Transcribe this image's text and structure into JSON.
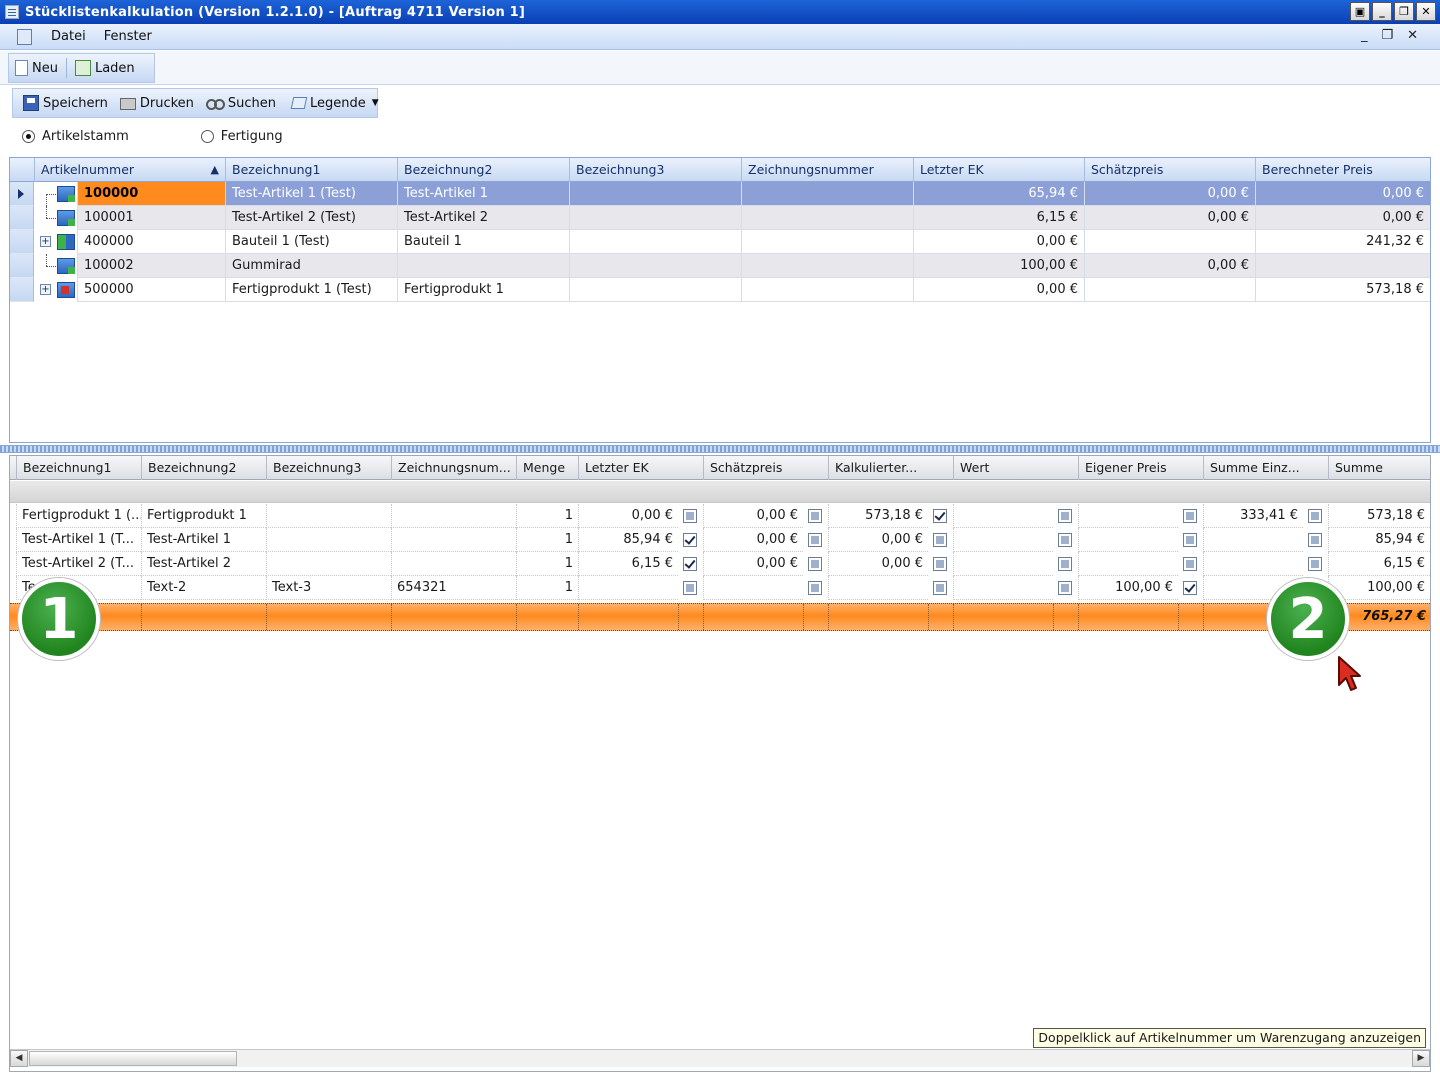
{
  "window": {
    "title": "Stücklistenkalkulation (Version 1.2.1.0) - [Auftrag 4711 Version 1]",
    "buttons": [
      "▣",
      "_",
      "❐",
      "✕"
    ]
  },
  "menu": {
    "items": [
      "Datei",
      "Fenster"
    ],
    "mdi_buttons": [
      "_",
      "❐",
      "✕"
    ]
  },
  "toolbar1": {
    "new_label": "Neu",
    "load_label": "Laden"
  },
  "toolbar2": {
    "save_label": "Speichern",
    "print_label": "Drucken",
    "search_label": "Suchen",
    "legend_label": "Legende"
  },
  "radios": {
    "opt1": "Artikelstamm",
    "opt2": "Fertigung"
  },
  "top_grid": {
    "columns": [
      "Artikelnummer",
      "Bezeichnung1",
      "Bezeichnung2",
      "Bezeichnung3",
      "Zeichnungsnummer",
      "Letzter EK",
      "Schätzpreis",
      "Berechneter Preis"
    ],
    "rows": [
      {
        "artnr": "100000",
        "bez1": "Test-Artikel 1  (Test)",
        "bez2": "Test-Artikel 1",
        "bez3": "",
        "zeich": "",
        "ek": "65,94 €",
        "schaetz": "0,00 €",
        "preis": "0,00 €"
      },
      {
        "artnr": "100001",
        "bez1": "Test-Artikel 2  (Test)",
        "bez2": "Test-Artikel 2",
        "bez3": "",
        "zeich": "",
        "ek": "6,15 €",
        "schaetz": "0,00 €",
        "preis": "0,00 €"
      },
      {
        "artnr": "400000",
        "bez1": "Bauteil 1  (Test)",
        "bez2": "Bauteil 1",
        "bez3": "",
        "zeich": "",
        "ek": "0,00 €",
        "schaetz": "",
        "preis": "241,32 €"
      },
      {
        "artnr": "100002",
        "bez1": "Gummirad",
        "bez2": "",
        "bez3": "",
        "zeich": "",
        "ek": "100,00 €",
        "schaetz": "0,00 €",
        "preis": ""
      },
      {
        "artnr": "500000",
        "bez1": "Fertigprodukt 1  (Test)",
        "bez2": "Fertigprodukt 1",
        "bez3": "",
        "zeich": "",
        "ek": "0,00 €",
        "schaetz": "",
        "preis": "573,18 €"
      }
    ]
  },
  "bottom_grid": {
    "columns": [
      "Bezeichnung1",
      "Bezeichnung2",
      "Bezeichnung3",
      "Zeichnungsnum...",
      "Menge",
      "Letzter EK",
      "Schätzpreis",
      "Kalkulierter...",
      "Wert",
      "Eigener Preis",
      "Summe Einz...",
      "Summe"
    ],
    "rows": [
      {
        "bez1": "Fertigprodukt 1   (...",
        "bez2": "Fertigprodukt 1",
        "bez3": "",
        "zeich": "",
        "menge": "1",
        "ek": "0,00 €",
        "schaetz": "0,00 €",
        "kalk": "573,18 €",
        "wert": "",
        "eigen": "",
        "einz": "333,41 €",
        "summe": "573,18 €"
      },
      {
        "bez1": "Test-Artikel 1   (T...",
        "bez2": "Test-Artikel 1",
        "bez3": "",
        "zeich": "",
        "menge": "1",
        "ek": "85,94 €",
        "schaetz": "0,00 €",
        "kalk": "0,00 €",
        "wert": "",
        "eigen": "",
        "einz": "",
        "summe": "85,94 €"
      },
      {
        "bez1": "Test-Artikel 2   (T...",
        "bez2": "Test-Artikel 2",
        "bez3": "",
        "zeich": "",
        "menge": "1",
        "ek": "6,15 €",
        "schaetz": "0,00 €",
        "kalk": "0,00 €",
        "wert": "",
        "eigen": "",
        "einz": "",
        "summe": "6,15 €"
      },
      {
        "bez1": "Te",
        "bez2": "Text-2",
        "bez3": "Text-3",
        "zeich": "654321",
        "menge": "1",
        "ek": "",
        "schaetz": "",
        "kalk": "",
        "wert": "",
        "eigen": "100,00 €",
        "einz": "",
        "summe": "100,00 €"
      }
    ],
    "total": "765,27 €"
  },
  "markers": {
    "m1": "1",
    "m2": "2"
  },
  "hint": "Doppelklick auf Artikelnummer um Warenzugang anzuzeigen",
  "colors": {
    "selection_orange": "#ff8a1e",
    "selection_blue": "#8ca0d7",
    "marker_green": "#2e9a2c"
  }
}
